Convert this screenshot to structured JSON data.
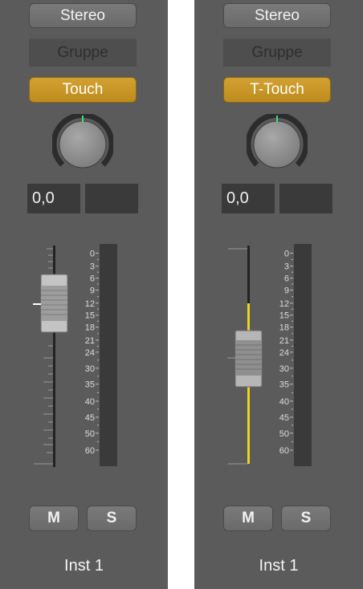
{
  "strips": [
    {
      "output_label": "Stereo",
      "group_label": "Gruppe",
      "automation_mode": "Touch",
      "pan_value": "0,0",
      "meter_scale": [
        "0",
        "3",
        "6",
        "9",
        "12",
        "15",
        "18",
        "21",
        "24",
        "30",
        "35",
        "40",
        "45",
        "50",
        "60"
      ],
      "mute_label": "M",
      "solo_label": "S",
      "track_name": "Inst 1"
    },
    {
      "output_label": "Stereo",
      "group_label": "Gruppe",
      "automation_mode": "T-Touch",
      "pan_value": "0,0",
      "meter_scale": [
        "0",
        "3",
        "6",
        "9",
        "12",
        "15",
        "18",
        "21",
        "24",
        "30",
        "35",
        "40",
        "45",
        "50",
        "60"
      ],
      "mute_label": "M",
      "solo_label": "S",
      "track_name": "Inst 1"
    }
  ],
  "colors": {
    "strip_bg": "#5b5b5b",
    "automation_yellow": "#c9972a",
    "automation_line": "#f0d21c",
    "pan_indicator": "#3ee07a"
  }
}
